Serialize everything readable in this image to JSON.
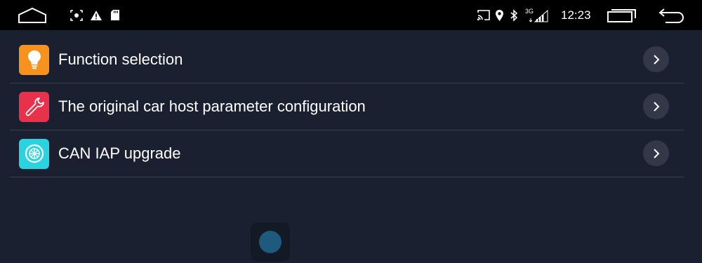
{
  "status_bar": {
    "time": "12:23",
    "network": "3G",
    "icons": [
      "home-icon",
      "screenshot-icon",
      "warning-icon",
      "sd-card-icon",
      "cast-icon",
      "location-icon",
      "bluetooth-icon",
      "signal-icon",
      "recent-apps-icon",
      "back-icon"
    ]
  },
  "menu": {
    "items": [
      {
        "label": "Function selection",
        "icon": "lightbulb-icon",
        "icon_color": "#f7921e"
      },
      {
        "label": "The original car host parameter configuration",
        "icon": "wrench-icon",
        "icon_color": "#e8314a"
      },
      {
        "label": "CAN IAP upgrade",
        "icon": "wheel-icon",
        "icon_color": "#2bd3e0"
      }
    ]
  },
  "colors": {
    "background": "#1b2030",
    "status_bar": "#000000",
    "divider": "#3a3f4c",
    "chevron_bg": "#323848"
  }
}
